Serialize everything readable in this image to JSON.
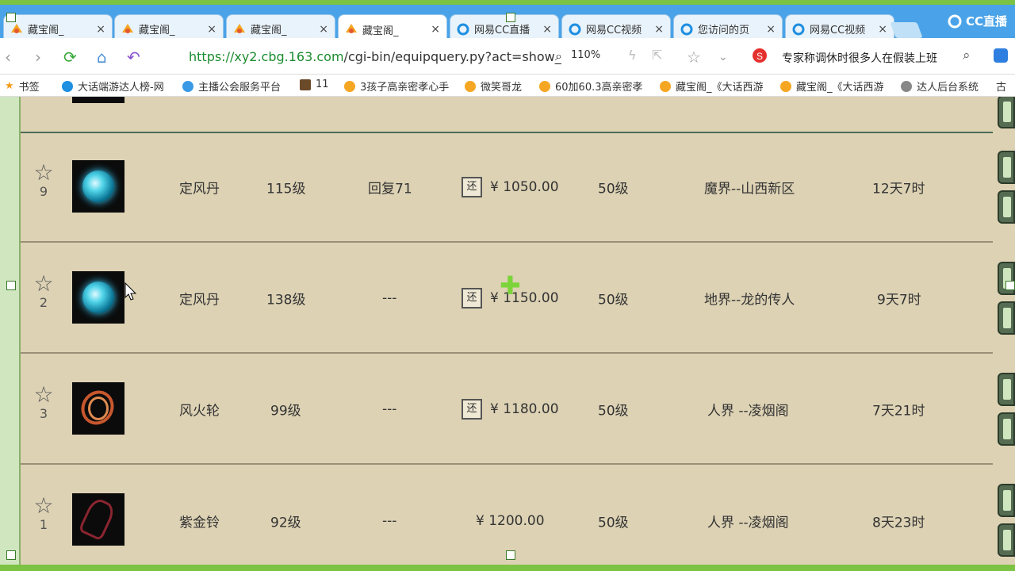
{
  "tabs": [
    {
      "label": "藏宝阁_",
      "icon": "cbg-icon",
      "active": false
    },
    {
      "label": "藏宝阁_",
      "icon": "cbg-icon",
      "active": false
    },
    {
      "label": "藏宝阁_",
      "icon": "cbg-icon",
      "active": false
    },
    {
      "label": "藏宝阁_",
      "icon": "cbg-icon",
      "active": true
    },
    {
      "label": "网易CC直播",
      "icon": "cc-icon",
      "active": false
    },
    {
      "label": "网易CC视频",
      "icon": "cc-icon",
      "active": false
    },
    {
      "label": "您访问的页",
      "icon": "cc-icon",
      "active": false
    },
    {
      "label": "网易CC视频",
      "icon": "cc-icon",
      "active": false
    }
  ],
  "tab_close": "×",
  "brand": "CC直播",
  "address": {
    "scheme_host": "https://xy2.cbg.163.com",
    "path": "/cgi-bin/equipquery.py?act=show_",
    "zoom": "110%",
    "hot_news": "专家称调休时很多人在假装上班"
  },
  "bookmarks": [
    {
      "label": "书签"
    },
    {
      "label": "大话端游达人榜-网"
    },
    {
      "label": "主播公会服务平台"
    },
    {
      "label": "11"
    },
    {
      "label": "3孩子高亲密孝心手"
    },
    {
      "label": "微笑哥龙"
    },
    {
      "label": "60加60.3高亲密孝"
    },
    {
      "label": "藏宝阁_《大话西游"
    },
    {
      "label": "藏宝阁_《大话西游"
    },
    {
      "label": "达人后台系统"
    },
    {
      "label": "古"
    }
  ],
  "listing": [
    {
      "rank": "9",
      "name": "定风丹",
      "level": "115级",
      "effect": "回复71",
      "returnable": true,
      "return_label": "还",
      "price": "¥ 1050.00",
      "req": "50级",
      "server": "魔界--山西新区",
      "time_left": "12天7时",
      "thumb": "orb"
    },
    {
      "rank": "2",
      "name": "定风丹",
      "level": "138级",
      "effect": "---",
      "returnable": true,
      "return_label": "还",
      "price": "¥ 1150.00",
      "req": "50级",
      "server": "地界--龙的传人",
      "time_left": "9天7时",
      "thumb": "orb"
    },
    {
      "rank": "3",
      "name": "风火轮",
      "level": "99级",
      "effect": "---",
      "returnable": true,
      "return_label": "还",
      "price": "¥ 1180.00",
      "req": "50级",
      "server": "人界 --凌烟阁",
      "time_left": "7天21时",
      "thumb": "wheel"
    },
    {
      "rank": "1",
      "name": "紫金铃",
      "level": "92级",
      "effect": "---",
      "returnable": false,
      "return_label": "",
      "price": "¥ 1200.00",
      "req": "50级",
      "server": "人界 --凌烟阁",
      "time_left": "8天23时",
      "thumb": "bell"
    }
  ]
}
